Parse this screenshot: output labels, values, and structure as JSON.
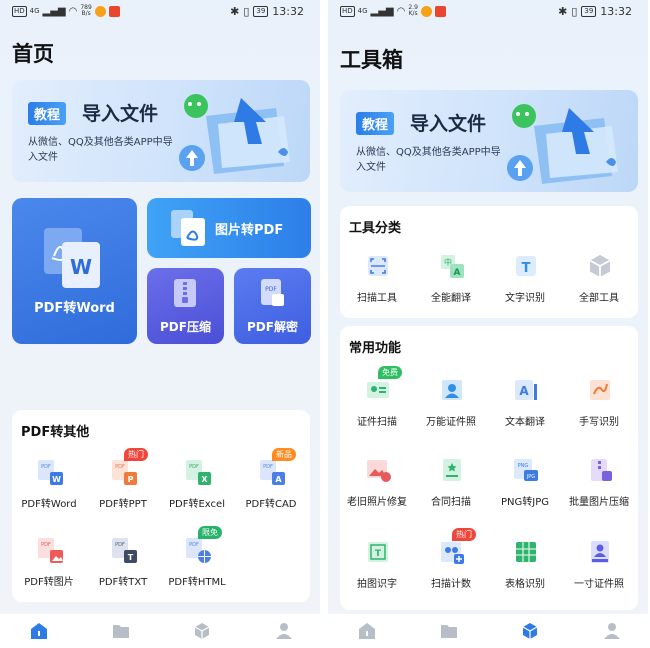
{
  "status_left": {
    "network": "HD",
    "signal": "4G",
    "speed_left": "789\nB/s",
    "speed_right": "2.9\nK/s"
  },
  "status_right": {
    "battery": "39",
    "time": "13:32"
  },
  "left": {
    "title": "首页",
    "banner": {
      "tag": "教程",
      "title": "导入文件",
      "subtitle": "从微信、QQ及其他各类APP中导入文件"
    },
    "hub": {
      "big": "PDF转Word",
      "wide": "图片转PDF",
      "small_a": "PDF压缩",
      "small_b": "PDF解密"
    },
    "section": {
      "title": "PDF转其他",
      "items": [
        {
          "label": "PDF转Word",
          "badge": ""
        },
        {
          "label": "PDF转PPT",
          "badge": "热门"
        },
        {
          "label": "PDF转Excel",
          "badge": ""
        },
        {
          "label": "PDF转CAD",
          "badge": "新品"
        },
        {
          "label": "PDF转图片",
          "badge": ""
        },
        {
          "label": "PDF转TXT",
          "badge": ""
        },
        {
          "label": "PDF转HTML",
          "badge": "限免"
        }
      ]
    }
  },
  "right": {
    "title": "工具箱",
    "banner": {
      "tag": "教程",
      "title": "导入文件",
      "subtitle": "从微信、QQ及其他各类APP中导入文件"
    },
    "categories": {
      "title": "工具分类",
      "items": [
        "扫描工具",
        "全能翻译",
        "文字识别",
        "全部工具"
      ]
    },
    "common": {
      "title": "常用功能",
      "items": [
        {
          "label": "证件扫描",
          "badge": "免费"
        },
        {
          "label": "万能证件照",
          "badge": ""
        },
        {
          "label": "文本翻译",
          "badge": ""
        },
        {
          "label": "手写识别",
          "badge": ""
        },
        {
          "label": "老旧照片修复",
          "badge": ""
        },
        {
          "label": "合同扫描",
          "badge": ""
        },
        {
          "label": "PNG转JPG",
          "badge": ""
        },
        {
          "label": "批量图片压缩",
          "badge": ""
        },
        {
          "label": "拍图识字",
          "badge": ""
        },
        {
          "label": "扫描计数",
          "badge": "热门"
        },
        {
          "label": "表格识别",
          "badge": ""
        },
        {
          "label": "一寸证件照",
          "badge": ""
        }
      ]
    }
  },
  "colors": {
    "accent": "#2f6cda",
    "hot": "#f0463a",
    "new": "#ff8a1f",
    "free": "#2fbf63"
  }
}
